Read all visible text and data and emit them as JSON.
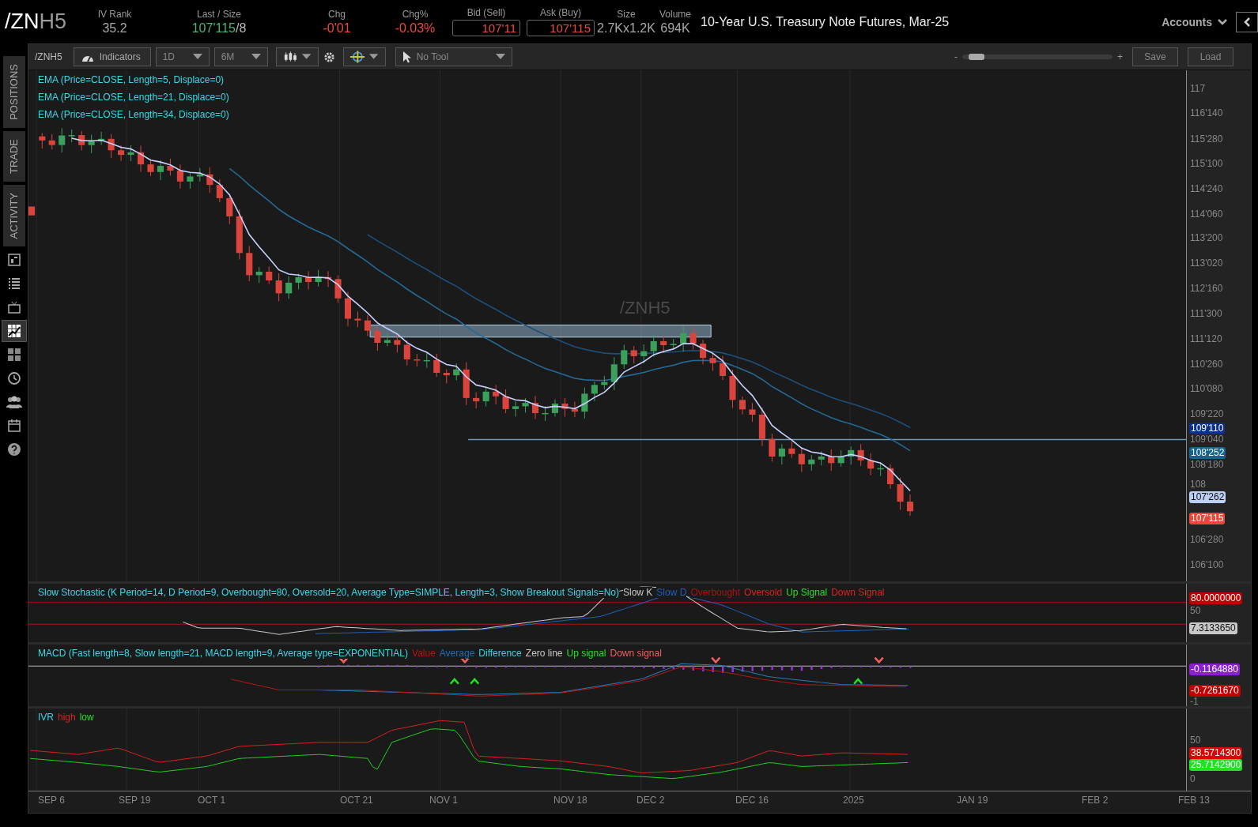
{
  "header": {
    "symbol_root": "/ZN",
    "symbol_suffix": "H5",
    "stats": [
      {
        "label": "IV Rank",
        "value": "35.2",
        "kind": "plain",
        "color": "#a8a8a8"
      },
      {
        "label": "Last / Size",
        "value": "107'115",
        "extra": "/8",
        "kind": "plain",
        "color": "#4fb46f"
      },
      {
        "label": "Chg",
        "value": "-0'01",
        "kind": "plain",
        "color": "#ec4a3c"
      },
      {
        "label": "Chg%",
        "value": "-0.03%",
        "kind": "plain",
        "color": "#ec4a3c"
      },
      {
        "label": "Bid (Sell)",
        "value": "107'11",
        "kind": "boxed",
        "color": "#ec4a3c"
      },
      {
        "label": "Ask (Buy)",
        "value": "107'115",
        "kind": "boxed",
        "color": "#ec4a3c"
      },
      {
        "label": "Size",
        "value": "2.7Kx1.2K",
        "kind": "plain",
        "color": "#a8a8a8"
      },
      {
        "label": "Volume",
        "value": "694K",
        "kind": "plain",
        "color": "#a8a8a8"
      }
    ],
    "description": "10-Year U.S. Treasury Note Futures, Mar-25",
    "accounts": "Accounts"
  },
  "sidebar": {
    "tabs": [
      {
        "label": "POSITIONS",
        "selected": false
      },
      {
        "label": "TRADE",
        "selected": false
      },
      {
        "label": "ACTIVITY",
        "selected": false
      }
    ],
    "icons": [
      {
        "selected": false
      },
      {
        "selected": false
      },
      {
        "selected": false
      },
      {
        "selected": true
      },
      {
        "selected": false
      },
      {
        "selected": false
      },
      {
        "selected": false
      },
      {
        "selected": false
      },
      {
        "selected": false
      }
    ]
  },
  "toolbar": {
    "symbol": "/ZNH5",
    "indicators": "Indicators",
    "interval": "1D",
    "range": "6M",
    "tool": "No Tool",
    "zoom_minus": "-",
    "zoom_plus": "+",
    "zoom": {
      "level": 0.05
    },
    "save": "Save",
    "load": "Load"
  },
  "chart": {
    "watermark": "/ZNH5",
    "studies": [
      "EMA (Price=CLOSE, Length=5, Displace=0)",
      "EMA (Price=CLOSE, Length=21, Displace=0)",
      "EMA (Price=CLOSE, Length=34, Displace=0)"
    ],
    "price_ticks": [
      "117",
      "116'140",
      "115'280",
      "115'100",
      "114'240",
      "114'060",
      "113'200",
      "113'020",
      "112'160",
      "111'300",
      "111'120",
      "110'260",
      "110'080",
      "109'220",
      "109'040",
      "108'180",
      "108",
      "106'280",
      "106'100"
    ],
    "price_badges": [
      {
        "text": "109'110",
        "color": "#0b2f8a"
      },
      {
        "text": "108'252",
        "color": "#136591"
      },
      {
        "text": "107'262",
        "color": "#bcd0f7"
      },
      {
        "text": "107'115",
        "color": "#e8473a"
      }
    ]
  },
  "stochastic": {
    "title": "Slow Stochastic (K Period=14, D Period=9, Overbought=80, Oversold=20, Average Type=SIMPLE, Length=3, Show Breakout Signals=No)",
    "legend": [
      {
        "text": "Slow K",
        "color": "#c8c8c8"
      },
      {
        "text": "Slow D",
        "color": "#1f5fb8"
      },
      {
        "text": "Overbought",
        "color": "#b01010"
      },
      {
        "text": "Oversold",
        "color": "#e02020"
      },
      {
        "text": "Up Signal",
        "color": "#22e022"
      },
      {
        "text": "Down Signal",
        "color": "#e02020"
      }
    ],
    "axis_labels": [
      {
        "text": "80.0000000",
        "color": "#c00000"
      },
      {
        "text": "50"
      },
      {
        "text": "7.3133650",
        "color": "#c8c8c8"
      }
    ]
  },
  "macd": {
    "title": "MACD (Fast length=8, Slow length=21, MACD length=9, Average type=EXPONENTIAL)",
    "legend": [
      {
        "text": "Value",
        "color": "#c01010"
      },
      {
        "text": "Average",
        "color": "#1f6fb0"
      },
      {
        "text": "Difference",
        "color": "#3fd0e0"
      },
      {
        "text": "Zero line",
        "color": "#c8c8c8"
      },
      {
        "text": "Up signal",
        "color": "#22e022"
      },
      {
        "text": "Down signal",
        "color": "#f06060"
      }
    ],
    "axis_labels": [
      {
        "text": "-0.1164880",
        "color": "#8a1fd0"
      },
      {
        "text": "-0.7261670",
        "color": "#c00000"
      },
      {
        "text": "-1"
      }
    ]
  },
  "ivr": {
    "title": "IVR",
    "legend": [
      {
        "text": "high",
        "color": "#e02020"
      },
      {
        "text": "low",
        "color": "#22e022"
      }
    ],
    "axis_labels": [
      {
        "text": "50"
      },
      {
        "text": "38.5714300",
        "color": "#e00000"
      },
      {
        "text": "25.7142900",
        "color": "#22e022"
      },
      {
        "text": "0"
      }
    ]
  },
  "date_axis": [
    "SEP 6",
    "SEP 19",
    "OCT 1",
    "OCT 21",
    "NOV 1",
    "NOV 18",
    "DEC 2",
    "DEC 16",
    "2025",
    "JAN 19",
    "FEB 2",
    "FEB 13"
  ]
}
